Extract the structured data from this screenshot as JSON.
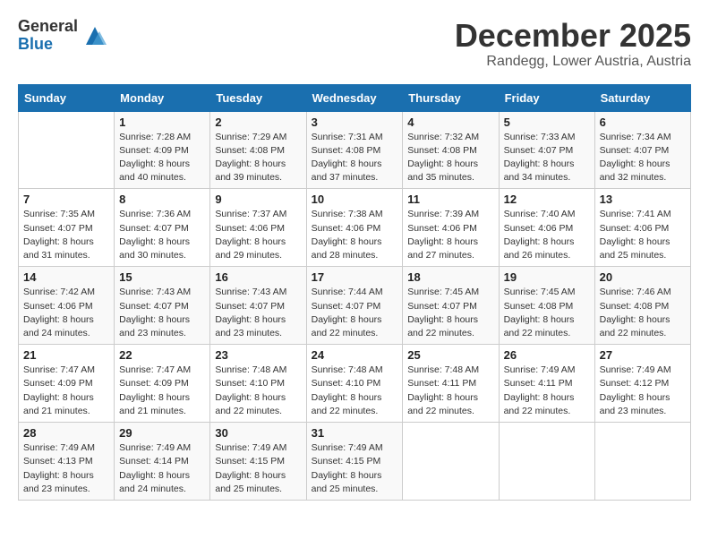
{
  "logo": {
    "general": "General",
    "blue": "Blue"
  },
  "title": "December 2025",
  "location": "Randegg, Lower Austria, Austria",
  "days_of_week": [
    "Sunday",
    "Monday",
    "Tuesday",
    "Wednesday",
    "Thursday",
    "Friday",
    "Saturday"
  ],
  "weeks": [
    [
      {
        "num": "",
        "info": ""
      },
      {
        "num": "1",
        "info": "Sunrise: 7:28 AM\nSunset: 4:09 PM\nDaylight: 8 hours\nand 40 minutes."
      },
      {
        "num": "2",
        "info": "Sunrise: 7:29 AM\nSunset: 4:08 PM\nDaylight: 8 hours\nand 39 minutes."
      },
      {
        "num": "3",
        "info": "Sunrise: 7:31 AM\nSunset: 4:08 PM\nDaylight: 8 hours\nand 37 minutes."
      },
      {
        "num": "4",
        "info": "Sunrise: 7:32 AM\nSunset: 4:08 PM\nDaylight: 8 hours\nand 35 minutes."
      },
      {
        "num": "5",
        "info": "Sunrise: 7:33 AM\nSunset: 4:07 PM\nDaylight: 8 hours\nand 34 minutes."
      },
      {
        "num": "6",
        "info": "Sunrise: 7:34 AM\nSunset: 4:07 PM\nDaylight: 8 hours\nand 32 minutes."
      }
    ],
    [
      {
        "num": "7",
        "info": "Sunrise: 7:35 AM\nSunset: 4:07 PM\nDaylight: 8 hours\nand 31 minutes."
      },
      {
        "num": "8",
        "info": "Sunrise: 7:36 AM\nSunset: 4:07 PM\nDaylight: 8 hours\nand 30 minutes."
      },
      {
        "num": "9",
        "info": "Sunrise: 7:37 AM\nSunset: 4:06 PM\nDaylight: 8 hours\nand 29 minutes."
      },
      {
        "num": "10",
        "info": "Sunrise: 7:38 AM\nSunset: 4:06 PM\nDaylight: 8 hours\nand 28 minutes."
      },
      {
        "num": "11",
        "info": "Sunrise: 7:39 AM\nSunset: 4:06 PM\nDaylight: 8 hours\nand 27 minutes."
      },
      {
        "num": "12",
        "info": "Sunrise: 7:40 AM\nSunset: 4:06 PM\nDaylight: 8 hours\nand 26 minutes."
      },
      {
        "num": "13",
        "info": "Sunrise: 7:41 AM\nSunset: 4:06 PM\nDaylight: 8 hours\nand 25 minutes."
      }
    ],
    [
      {
        "num": "14",
        "info": "Sunrise: 7:42 AM\nSunset: 4:06 PM\nDaylight: 8 hours\nand 24 minutes."
      },
      {
        "num": "15",
        "info": "Sunrise: 7:43 AM\nSunset: 4:07 PM\nDaylight: 8 hours\nand 23 minutes."
      },
      {
        "num": "16",
        "info": "Sunrise: 7:43 AM\nSunset: 4:07 PM\nDaylight: 8 hours\nand 23 minutes."
      },
      {
        "num": "17",
        "info": "Sunrise: 7:44 AM\nSunset: 4:07 PM\nDaylight: 8 hours\nand 22 minutes."
      },
      {
        "num": "18",
        "info": "Sunrise: 7:45 AM\nSunset: 4:07 PM\nDaylight: 8 hours\nand 22 minutes."
      },
      {
        "num": "19",
        "info": "Sunrise: 7:45 AM\nSunset: 4:08 PM\nDaylight: 8 hours\nand 22 minutes."
      },
      {
        "num": "20",
        "info": "Sunrise: 7:46 AM\nSunset: 4:08 PM\nDaylight: 8 hours\nand 22 minutes."
      }
    ],
    [
      {
        "num": "21",
        "info": "Sunrise: 7:47 AM\nSunset: 4:09 PM\nDaylight: 8 hours\nand 21 minutes."
      },
      {
        "num": "22",
        "info": "Sunrise: 7:47 AM\nSunset: 4:09 PM\nDaylight: 8 hours\nand 21 minutes."
      },
      {
        "num": "23",
        "info": "Sunrise: 7:48 AM\nSunset: 4:10 PM\nDaylight: 8 hours\nand 22 minutes."
      },
      {
        "num": "24",
        "info": "Sunrise: 7:48 AM\nSunset: 4:10 PM\nDaylight: 8 hours\nand 22 minutes."
      },
      {
        "num": "25",
        "info": "Sunrise: 7:48 AM\nSunset: 4:11 PM\nDaylight: 8 hours\nand 22 minutes."
      },
      {
        "num": "26",
        "info": "Sunrise: 7:49 AM\nSunset: 4:11 PM\nDaylight: 8 hours\nand 22 minutes."
      },
      {
        "num": "27",
        "info": "Sunrise: 7:49 AM\nSunset: 4:12 PM\nDaylight: 8 hours\nand 23 minutes."
      }
    ],
    [
      {
        "num": "28",
        "info": "Sunrise: 7:49 AM\nSunset: 4:13 PM\nDaylight: 8 hours\nand 23 minutes."
      },
      {
        "num": "29",
        "info": "Sunrise: 7:49 AM\nSunset: 4:14 PM\nDaylight: 8 hours\nand 24 minutes."
      },
      {
        "num": "30",
        "info": "Sunrise: 7:49 AM\nSunset: 4:15 PM\nDaylight: 8 hours\nand 25 minutes."
      },
      {
        "num": "31",
        "info": "Sunrise: 7:49 AM\nSunset: 4:15 PM\nDaylight: 8 hours\nand 25 minutes."
      },
      {
        "num": "",
        "info": ""
      },
      {
        "num": "",
        "info": ""
      },
      {
        "num": "",
        "info": ""
      }
    ]
  ]
}
